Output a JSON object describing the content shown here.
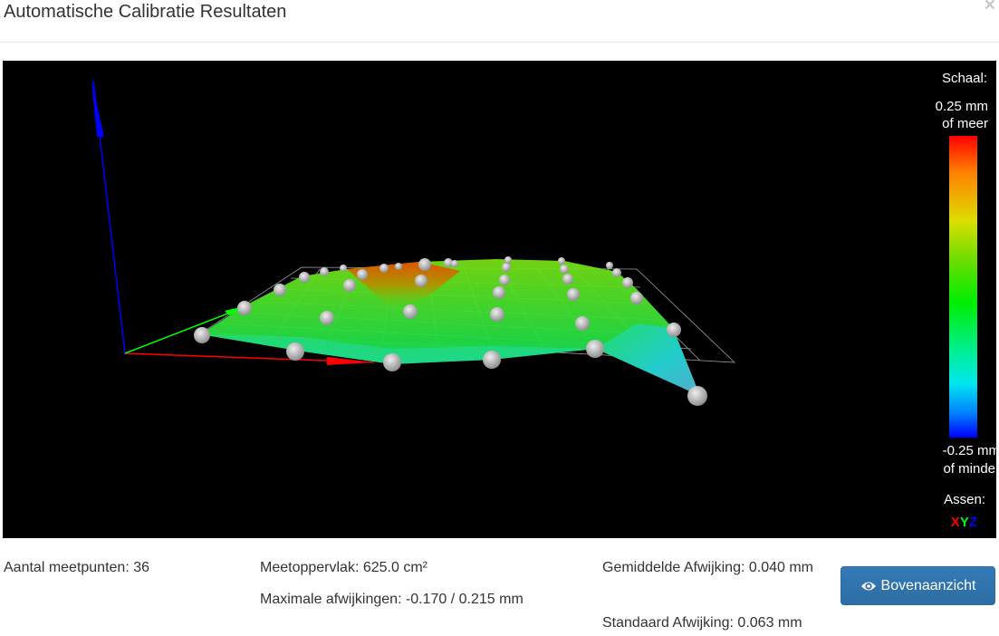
{
  "dialog": {
    "title": "Automatische Calibratie Resultaten",
    "close_label": "×"
  },
  "legend": {
    "scale_title": "Schaal:",
    "max_value": "0.25 mm",
    "max_suffix": "of meer",
    "min_value": "-0.25 mm",
    "min_suffix": "of minder",
    "axes_title": "Assen:",
    "axis_x": "X",
    "axis_y": "Y",
    "axis_z": "Z",
    "colors": {
      "x": "#ff0000",
      "y": "#00ff00",
      "z": "#0000ff"
    }
  },
  "stats": {
    "points": "Aantal meetpunten: 36",
    "area": "Meetoppervlak: 625.0 cm²",
    "max_dev": "Maximale afwijkingen: -0.170 / 0.215 mm",
    "avg_dev": "Gemiddelde Afwijking: 0.040 mm",
    "std_dev": "Standaard Afwijking: 0.063 mm"
  },
  "buttons": {
    "top_view": "Bovenaanzicht",
    "top_view_icon": "eye-icon"
  }
}
